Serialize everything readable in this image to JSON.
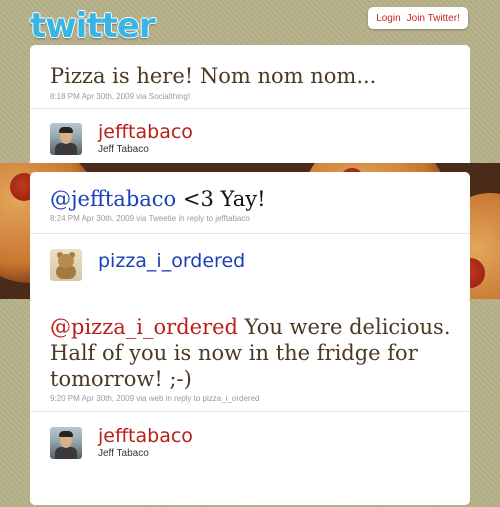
{
  "header": {
    "logo": "twitter",
    "login": "Login",
    "join": "Join Twitter!"
  },
  "tweets": [
    {
      "text": "Pizza is here! Nom nom nom...",
      "meta": "8:18 PM Apr 30th, 2009 via Socialthing!",
      "username": "jefftabaco",
      "fullname": "Jeff Tabaco"
    },
    {
      "mention": "@jefftabaco",
      "text": " <3 Yay!",
      "meta": "8:24 PM Apr 30th, 2009 via Tweetie in reply to jefftabaco",
      "username": "pizza_i_ordered"
    },
    {
      "mention": "@pizza_i_ordered",
      "text_line1": " You were delicious.",
      "text_line2": "Half of you is now in the fridge for",
      "text_line3": "tomorrow! ;-)",
      "meta": "9:20 PM Apr 30th, 2009 via web in reply to pizza_i_ordered",
      "username": "jefftabaco",
      "fullname": "Jeff Tabaco"
    }
  ],
  "colors": {
    "background": "#b6b18a",
    "logo": "#37b6e6",
    "link_red": "#b8201b",
    "link_blue": "#1a3fb8"
  }
}
